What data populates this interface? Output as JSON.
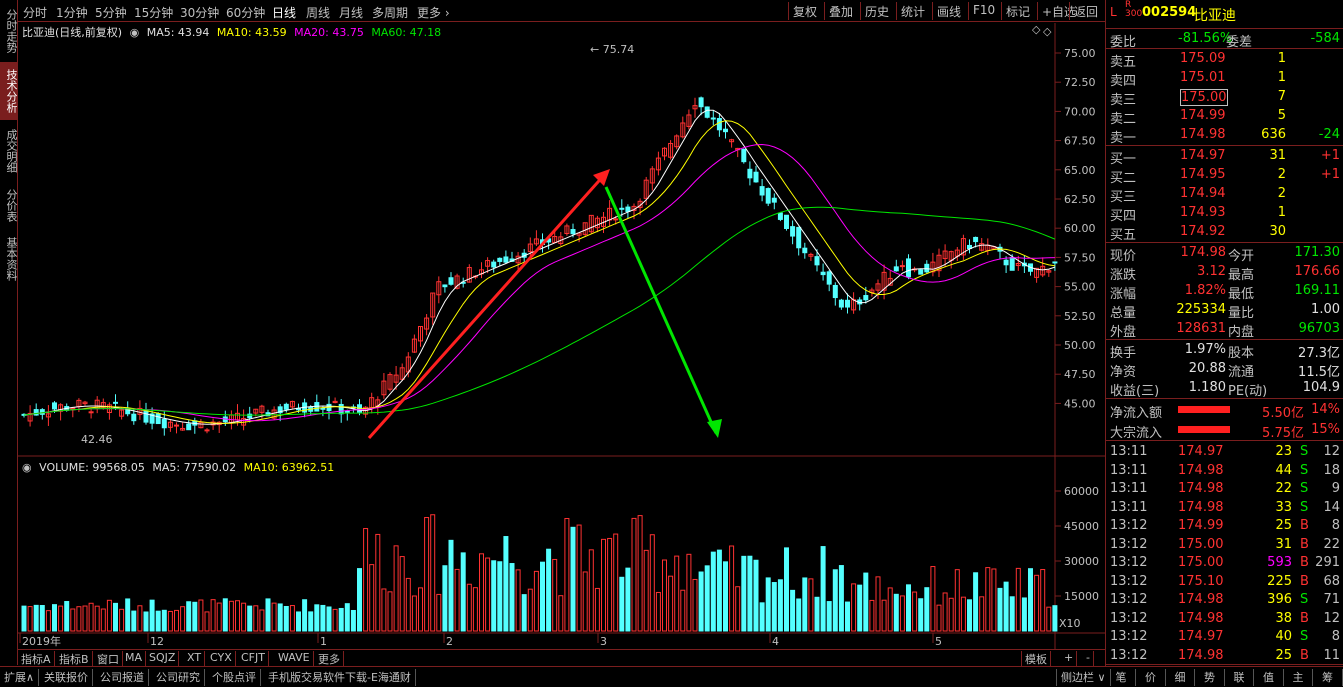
{
  "left_tabs": [
    {
      "label": "分时走势"
    },
    {
      "label": "技术分析"
    },
    {
      "label": "成交明细"
    },
    {
      "label": "分价表"
    },
    {
      "label": "基本资料"
    }
  ],
  "periods": [
    "分时",
    "1分钟",
    "5分钟",
    "15分钟",
    "30分钟",
    "60分钟",
    "日线",
    "周线",
    "月线",
    "多周期",
    "更多"
  ],
  "selected_period": "日线",
  "toolbar": [
    "复权",
    "叠加",
    "历史",
    "统计",
    "画线",
    "F10",
    "标记",
    "+自选",
    "返回"
  ],
  "chart_header": {
    "name": "比亚迪(日线,前复权)",
    "ma5": "MA5: 43.94",
    "ma10": "MA10: 43.59",
    "ma20": "MA20: 43.75",
    "ma60": "MA60: 47.18"
  },
  "price_axis": [
    "75.00",
    "72.50",
    "70.00",
    "67.50",
    "65.00",
    "62.50",
    "60.00",
    "57.50",
    "55.00",
    "52.50",
    "50.00",
    "47.50",
    "45.00"
  ],
  "annotations": {
    "high": "75.74",
    "low": "42.46"
  },
  "volume_header": {
    "label": "VOLUME: 99568.05",
    "ma5": "MA5: 77590.02",
    "ma10": "MA10: 63962.51"
  },
  "volume_axis": [
    "60000",
    "45000",
    "30000",
    "15000"
  ],
  "volume_unit": "X10",
  "date_axis": [
    "2019年",
    "12",
    "1",
    "2",
    "3",
    "4",
    "5"
  ],
  "bottom_tabs": [
    "指标A",
    "指标B",
    "窗口",
    "MA",
    "SQJZ",
    "XT",
    "CYX",
    "CFJT",
    "WAVE",
    "更多"
  ],
  "bottom_right": [
    "模板",
    "+",
    "-"
  ],
  "status_bar": [
    "扩展∧",
    "关联报价",
    "公司报道",
    "公司研究",
    "个股点评",
    "手机版交易软件下载-E海通财"
  ],
  "status_right": "侧边栏 ∨",
  "stock": {
    "prefix": "L",
    "badge_top": "R",
    "badge_bottom": "300",
    "code": "002594",
    "name": "比亚迪"
  },
  "weibi": {
    "label1": "委比",
    "value1": "-81.56%",
    "label2": "委差",
    "value2": "-584"
  },
  "sells": [
    {
      "label": "卖五",
      "price": "175.09",
      "vol": "1",
      "chg": ""
    },
    {
      "label": "卖四",
      "price": "175.01",
      "vol": "1",
      "chg": ""
    },
    {
      "label": "卖三",
      "price": "175.00",
      "vol": "7",
      "chg": ""
    },
    {
      "label": "卖二",
      "price": "174.99",
      "vol": "5",
      "chg": ""
    },
    {
      "label": "卖一",
      "price": "174.98",
      "vol": "636",
      "chg": "-24"
    }
  ],
  "buys": [
    {
      "label": "买一",
      "price": "174.97",
      "vol": "31",
      "chg": "+1"
    },
    {
      "label": "买二",
      "price": "174.95",
      "vol": "2",
      "chg": "+1"
    },
    {
      "label": "买三",
      "price": "174.94",
      "vol": "2",
      "chg": ""
    },
    {
      "label": "买四",
      "price": "174.93",
      "vol": "1",
      "chg": ""
    },
    {
      "label": "买五",
      "price": "174.92",
      "vol": "30",
      "chg": ""
    }
  ],
  "quote": [
    {
      "l1": "现价",
      "v1": "174.98",
      "l2": "今开",
      "v2": "171.30"
    },
    {
      "l1": "涨跌",
      "v1": "3.12",
      "l2": "最高",
      "v2": "176.66"
    },
    {
      "l1": "涨幅",
      "v1": "1.82%",
      "l2": "最低",
      "v2": "169.11"
    },
    {
      "l1": "总量",
      "v1": "225334",
      "l2": "量比",
      "v2": "1.00"
    },
    {
      "l1": "外盘",
      "v1": "128631",
      "l2": "内盘",
      "v2": "96703"
    }
  ],
  "quote2": [
    {
      "l1": "换手",
      "v1": "1.97%",
      "l2": "股本",
      "v2": "27.3亿"
    },
    {
      "l1": "净资",
      "v1": "20.88",
      "l2": "流通",
      "v2": "11.5亿"
    },
    {
      "l1": "收益(三)",
      "v1": "1.180",
      "l2": "PE(动)",
      "v2": "104.9"
    }
  ],
  "flows": [
    {
      "label": "净流入额",
      "value": "5.50亿",
      "pct": "14%"
    },
    {
      "label": "大宗流入",
      "value": "5.75亿",
      "pct": "15%"
    }
  ],
  "ticks": [
    {
      "t": "13:11",
      "p": "174.97",
      "v": "23",
      "s": "S",
      "n": "12"
    },
    {
      "t": "13:11",
      "p": "174.98",
      "v": "44",
      "s": "S",
      "n": "18"
    },
    {
      "t": "13:11",
      "p": "174.98",
      "v": "22",
      "s": "S",
      "n": "9"
    },
    {
      "t": "13:11",
      "p": "174.98",
      "v": "33",
      "s": "S",
      "n": "14"
    },
    {
      "t": "13:12",
      "p": "174.99",
      "v": "25",
      "s": "B",
      "n": "8"
    },
    {
      "t": "13:12",
      "p": "175.00",
      "v": "31",
      "s": "B",
      "n": "22"
    },
    {
      "t": "13:12",
      "p": "175.00",
      "v": "593",
      "s": "B",
      "n": "291"
    },
    {
      "t": "13:12",
      "p": "175.10",
      "v": "225",
      "s": "B",
      "n": "68"
    },
    {
      "t": "13:12",
      "p": "174.98",
      "v": "396",
      "s": "S",
      "n": "71"
    },
    {
      "t": "13:12",
      "p": "174.98",
      "v": "38",
      "s": "B",
      "n": "12"
    },
    {
      "t": "13:12",
      "p": "174.97",
      "v": "40",
      "s": "S",
      "n": "8"
    },
    {
      "t": "13:12",
      "p": "174.98",
      "v": "25",
      "s": "B",
      "n": "11"
    }
  ],
  "right_bottom_tabs": [
    "笔",
    "价",
    "细",
    "势",
    "联",
    "值",
    "主",
    "筹"
  ],
  "colors": {
    "up": "#ff3232",
    "down": "#54ffff",
    "frame": "#7a1e1e",
    "ma5": "#ffffff",
    "ma10": "#ffff00",
    "ma20": "#ff00ff",
    "ma60": "#00e600"
  }
}
